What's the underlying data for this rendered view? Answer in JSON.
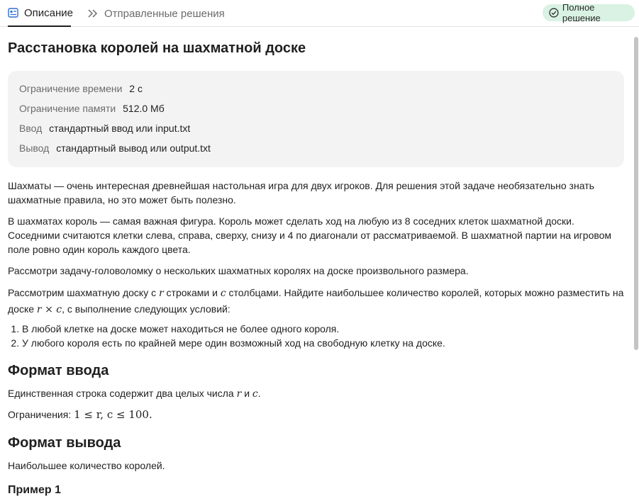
{
  "tabs": {
    "description": "Описание",
    "submissions": "Отправленные решения"
  },
  "status_badge": "Полное решение",
  "problem": {
    "title": "Расстановка королей на шахматной доске",
    "limits": {
      "time_label": "Ограничение времени",
      "time_value": "2 с",
      "memory_label": "Ограничение памяти",
      "memory_value": "512.0 Мб",
      "input_label": "Ввод",
      "input_value": "стандартный ввод или input.txt",
      "output_label": "Вывод",
      "output_value": "стандартный вывод или output.txt"
    },
    "paragraphs": {
      "p1": "Шахматы — очень интересная древнейшая настольная игра для двух игроков. Для решения этой задаче необязательно знать шахматные правила, но это может быть полезно.",
      "p2": "В шахматах король — самая важная фигура. Король может сделать ход на любую из 8 соседних клеток шахматной доски. Соседними считаются клетки слева, справа, сверху, снизу и 4 по диагонали от рассматриваемой. В шахматной партии на игровом поле ровно один король каждого цвета.",
      "p3": "Рассмотри задачу-головоломку о нескольких шахматных королях на доске произвольного размера.",
      "p4_a": "Рассмотрим шахматную доску с ",
      "p4_r": "r",
      "p4_b": " строками и ",
      "p4_c": "c",
      "p4_d": " столбцами. Найдите наибольшее количество королей, которых можно разместить на доске ",
      "p4_expr_r": "r",
      "p4_expr_times": " × ",
      "p4_expr_c": "c",
      "p4_e": ", с выполнение следующих условий:"
    },
    "conditions": [
      "В любой клетке на доске может находиться не более одного короля.",
      "У любого короля есть по крайней мере один возможный ход на свободную клетку на доске."
    ],
    "input_format": {
      "heading": "Формат ввода",
      "text_a": "Единственная строка содержит два целых числа ",
      "var_r": "r",
      "and": " и ",
      "var_c": "c",
      "text_end": ".",
      "constraints_label": "Ограничения: ",
      "constraints_expr": "1 ≤ r, c ≤ 100."
    },
    "output_format": {
      "heading": "Формат вывода",
      "text": "Наибольшее количество королей."
    },
    "example_heading": "Пример 1"
  }
}
